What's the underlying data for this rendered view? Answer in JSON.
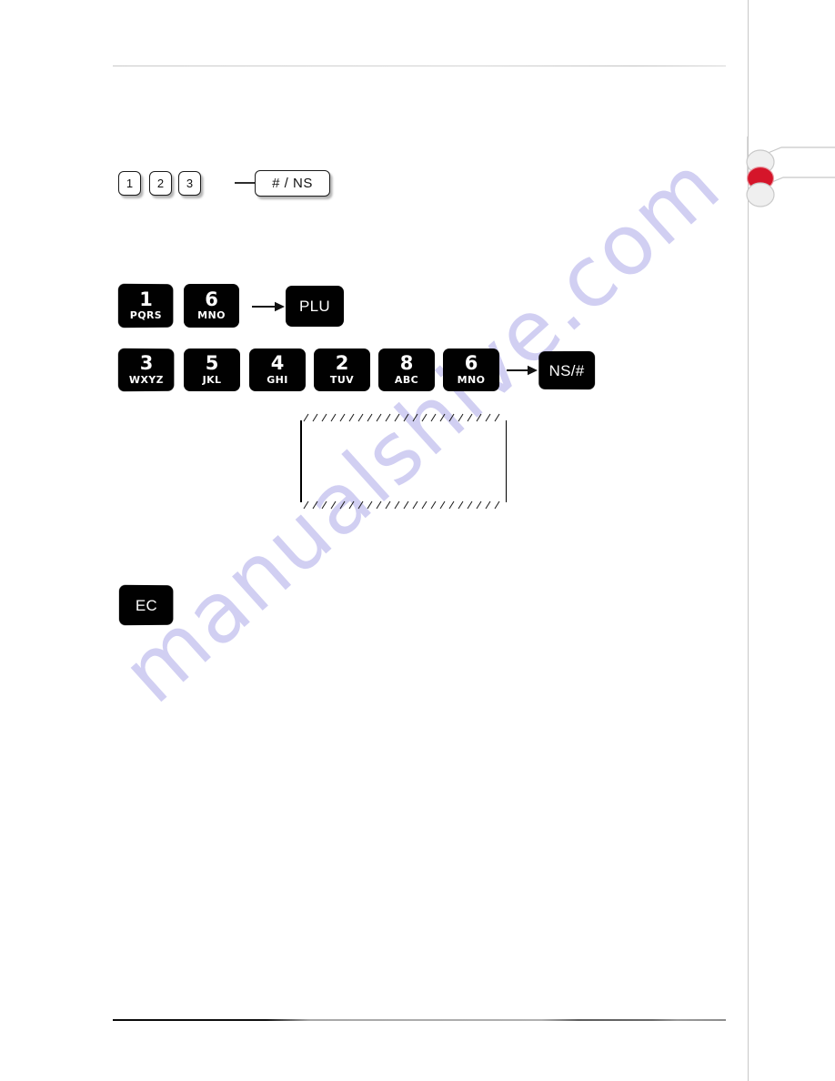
{
  "document": {
    "type": "manual-page",
    "watermark_text": "manualshive.com",
    "background_color": "#ffffff"
  },
  "page_marker": {
    "name": "section-tab-marker",
    "dots": [
      {
        "id": "dot-above",
        "color": "#efefef",
        "state": "inactive"
      },
      {
        "id": "dot-current",
        "color": "#d5152a",
        "state": "active"
      },
      {
        "id": "dot-below",
        "color": "#efefef",
        "state": "inactive"
      }
    ],
    "line_color": "#c8c8c8"
  },
  "sequences": [
    {
      "id": "sequence-1",
      "style": "white-keys",
      "keys": [
        {
          "name": "key-1",
          "main": "1",
          "sub": "",
          "shape": "small"
        },
        {
          "name": "key-2",
          "main": "2",
          "sub": "",
          "shape": "small"
        },
        {
          "name": "key-3",
          "main": "3",
          "sub": "",
          "shape": "small"
        }
      ],
      "arrow": "right-arrow",
      "result": {
        "name": "key-hash-ns",
        "main": "# / NS",
        "shape": "wide"
      }
    },
    {
      "id": "sequence-2",
      "style": "black-keys",
      "keys": [
        {
          "name": "key-1-pqrs",
          "main": "1",
          "sub": "PQRS"
        },
        {
          "name": "key-6-mno",
          "main": "6",
          "sub": "MNO"
        }
      ],
      "arrow": "right-arrow",
      "result": {
        "name": "key-plu",
        "main": "PLU",
        "sub": ""
      }
    },
    {
      "id": "sequence-3",
      "style": "black-keys",
      "keys": [
        {
          "name": "key-3-wxyz",
          "main": "3",
          "sub": "WXYZ"
        },
        {
          "name": "key-5-jkl",
          "main": "5",
          "sub": "JKL"
        },
        {
          "name": "key-4-ghi",
          "main": "4",
          "sub": "GHI"
        },
        {
          "name": "key-2-tuv",
          "main": "2",
          "sub": "TUV"
        },
        {
          "name": "key-8-abc",
          "main": "8",
          "sub": "ABC"
        },
        {
          "name": "key-6-mno",
          "main": "6",
          "sub": "MNO"
        }
      ],
      "arrow": "right-arrow",
      "result": {
        "name": "key-ns-hash",
        "main": "NS/#",
        "sub": ""
      }
    }
  ],
  "receipt_box": {
    "name": "receipt-paper-illustration",
    "content": "",
    "edges": "perforated-top-and-bottom"
  },
  "standalone_key": {
    "name": "key-ec",
    "main": "EC",
    "sub": ""
  }
}
